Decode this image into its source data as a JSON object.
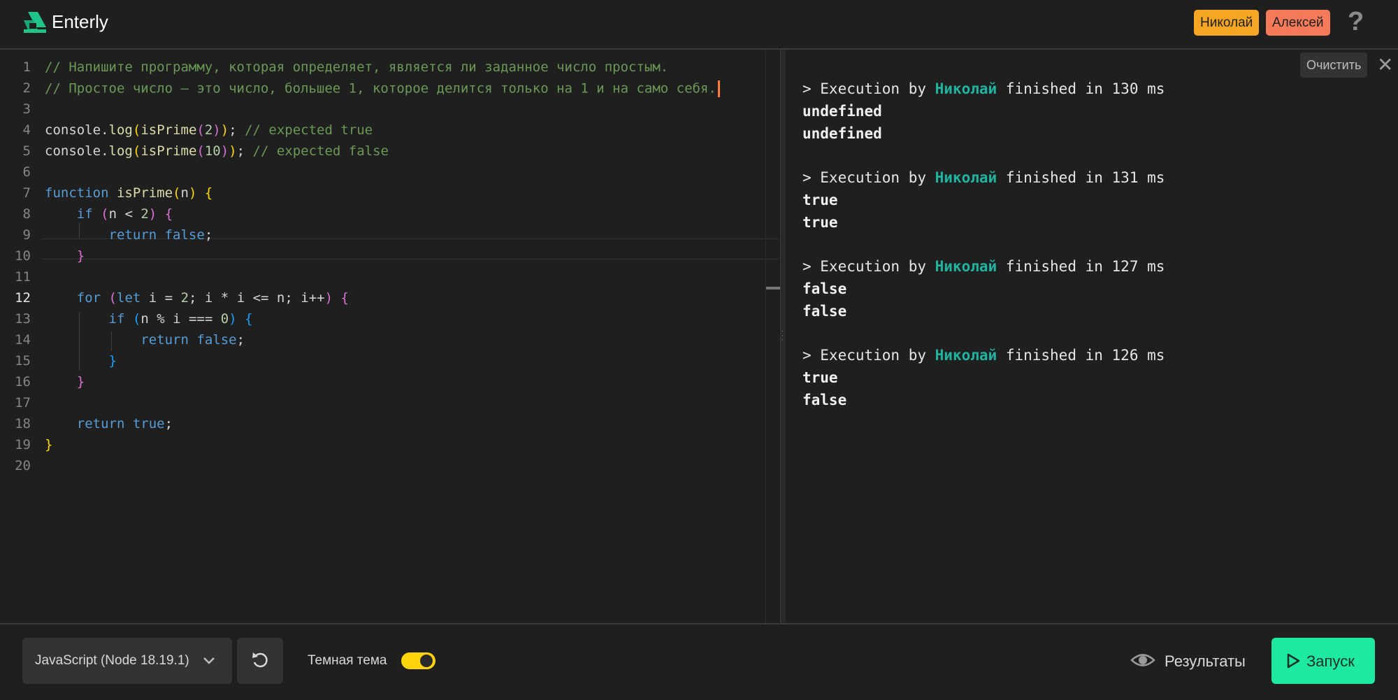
{
  "header": {
    "brand": "Enterly",
    "users": [
      {
        "name": "Николай",
        "color": "#f5a623"
      },
      {
        "name": "Алексей",
        "color": "#f47a5a"
      }
    ],
    "help": "?"
  },
  "editor": {
    "active_line": 12,
    "line_numbers": [
      "1",
      "2",
      "3",
      "4",
      "5",
      "6",
      "7",
      "8",
      "9",
      "10",
      "11",
      "12",
      "13",
      "14",
      "15",
      "16",
      "17",
      "18",
      "19",
      "20"
    ],
    "lines": [
      "// Напишите программу, которая определяет, является ли заданное число простым.",
      "// Простое число — это число, большее 1, которое делится только на 1 и на само себя.",
      "",
      "console.log(isPrime(2)); // expected true",
      "console.log(isPrime(10)); // expected false",
      "",
      "function isPrime(n) {",
      "    if (n < 2) {",
      "        return false;",
      "    }",
      "",
      "    for (let i = 2; i * i <= n; i++) {",
      "        if (n % i === 0) {",
      "            return false;",
      "        }",
      "    }",
      "",
      "    return true;",
      "}",
      ""
    ]
  },
  "output": {
    "clear_label": "Очистить",
    "close_label": "✕",
    "runs": [
      {
        "prefix": "> Execution by ",
        "user": "Николай",
        "suffix": " finished in 130 ms",
        "values": [
          "undefined",
          "undefined"
        ]
      },
      {
        "prefix": "> Execution by ",
        "user": "Николай",
        "suffix": " finished in 131 ms",
        "values": [
          "true",
          "true"
        ]
      },
      {
        "prefix": "> Execution by ",
        "user": "Николай",
        "suffix": " finished in 127 ms",
        "values": [
          "false",
          "false"
        ]
      },
      {
        "prefix": "> Execution by ",
        "user": "Николай",
        "suffix": " finished in 126 ms",
        "values": [
          "true",
          "false"
        ]
      }
    ]
  },
  "footer": {
    "language": "JavaScript (Node 18.19.1)",
    "theme_label": "Темная тема",
    "dark_theme_on": true,
    "results_label": "Результаты",
    "run_label": "Запуск"
  }
}
